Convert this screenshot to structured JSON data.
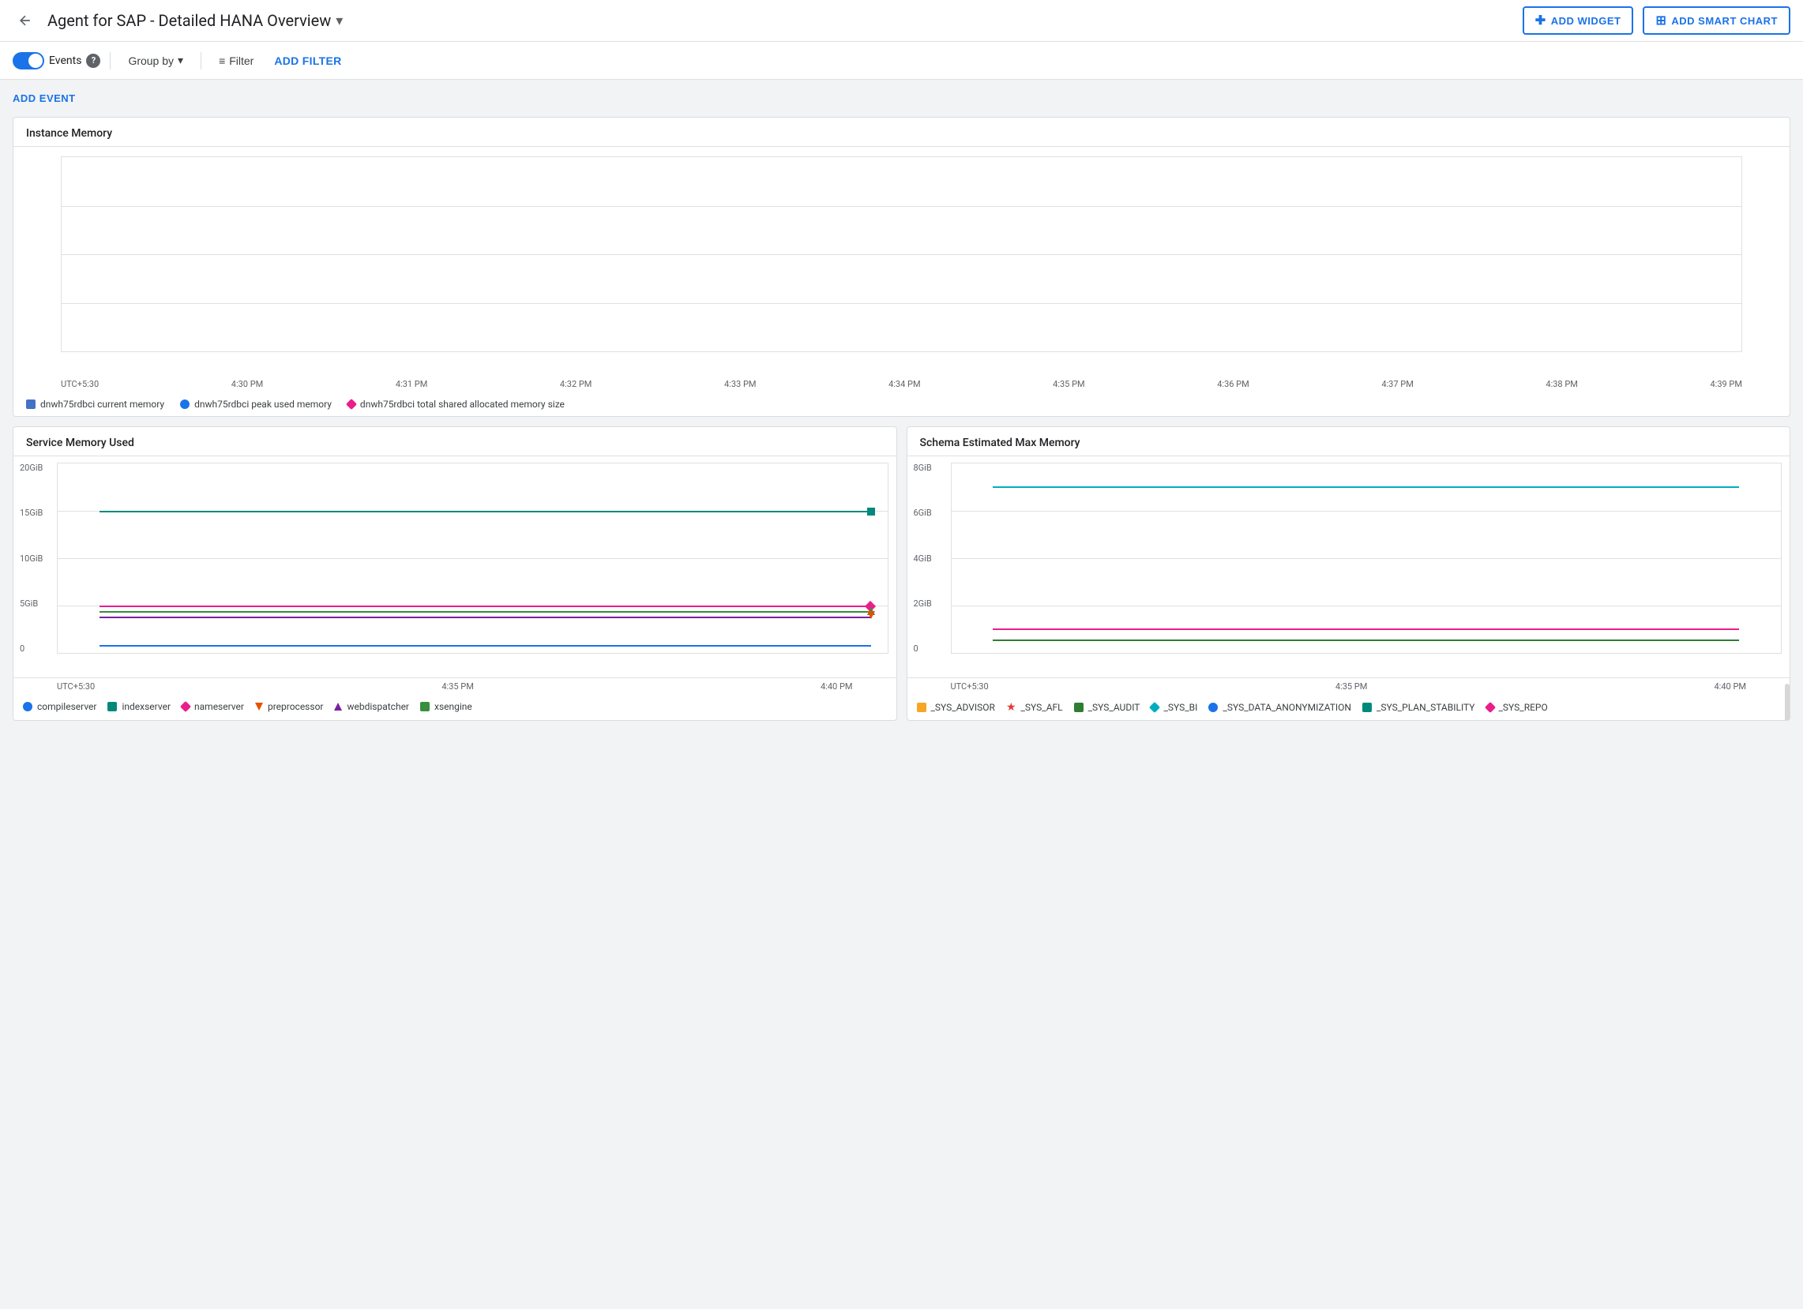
{
  "header": {
    "back_label": "←",
    "title": "Agent for SAP - Detailed HANA Overview",
    "title_dropdown_icon": "▾",
    "add_widget_label": "ADD WIDGET",
    "add_smart_chart_label": "ADD SMART CHART"
  },
  "toolbar": {
    "events_label": "Events",
    "info_icon": "?",
    "group_by_label": "Group by",
    "dropdown_icon": "▾",
    "filter_label": "Filter",
    "add_filter_label": "ADD FILTER"
  },
  "content": {
    "add_event_label": "ADD EVENT"
  },
  "instance_memory": {
    "title": "Instance Memory",
    "time_axis": [
      "UTC+5:30",
      "4:30 PM",
      "4:31 PM",
      "4:32 PM",
      "4:33 PM",
      "4:34 PM",
      "4:35 PM",
      "4:36 PM",
      "4:37 PM",
      "4:38 PM",
      "4:39 PM"
    ],
    "legend": [
      {
        "label": "dnwh75rdbci current memory",
        "color": "#4472c4",
        "shape": "square"
      },
      {
        "label": "dnwh75rdbci peak used memory",
        "color": "#1a73e8",
        "shape": "circle"
      },
      {
        "label": "dnwh75rdbci total shared allocated memory size",
        "color": "#e91e8c",
        "shape": "diamond"
      }
    ]
  },
  "service_memory": {
    "title": "Service Memory Used",
    "y_labels": [
      "20GiB",
      "15GiB",
      "10GiB",
      "5GiB",
      "0"
    ],
    "time_axis": [
      "UTC+5:30",
      "4:35 PM",
      "4:40 PM"
    ],
    "legend": [
      {
        "label": "compileserver",
        "color": "#1a73e8",
        "shape": "circle"
      },
      {
        "label": "indexserver",
        "color": "#00897b",
        "shape": "square"
      },
      {
        "label": "nameserver",
        "color": "#e91e8c",
        "shape": "diamond"
      },
      {
        "label": "preprocessor",
        "color": "#e65100",
        "shape": "triangle-down"
      },
      {
        "label": "webdispatcher",
        "color": "#7b1fa2",
        "shape": "triangle-up"
      },
      {
        "label": "xsengine",
        "color": "#388e3c",
        "shape": "square"
      }
    ]
  },
  "schema_memory": {
    "title": "Schema Estimated Max Memory",
    "y_labels": [
      "8GiB",
      "6GiB",
      "4GiB",
      "2GiB",
      "0"
    ],
    "time_axis": [
      "UTC+5:30",
      "4:35 PM",
      "4:40 PM"
    ],
    "legend": [
      {
        "label": "_SYS_ADVISOR",
        "color": "#f6a623",
        "shape": "square"
      },
      {
        "label": "_SYS_AFL",
        "color": "#e53935",
        "shape": "star"
      },
      {
        "label": "_SYS_AUDIT",
        "color": "#2e7d32",
        "shape": "square"
      },
      {
        "label": "_SYS_BI",
        "color": "#00acc1",
        "shape": "diamond"
      },
      {
        "label": "_SYS_DATA_ANONYMIZATION",
        "color": "#1a73e8",
        "shape": "circle"
      },
      {
        "label": "_SYS_PLAN_STABILITY",
        "color": "#00897b",
        "shape": "square"
      },
      {
        "label": "_SYS_REPO",
        "color": "#e91e8c",
        "shape": "diamond"
      }
    ]
  }
}
